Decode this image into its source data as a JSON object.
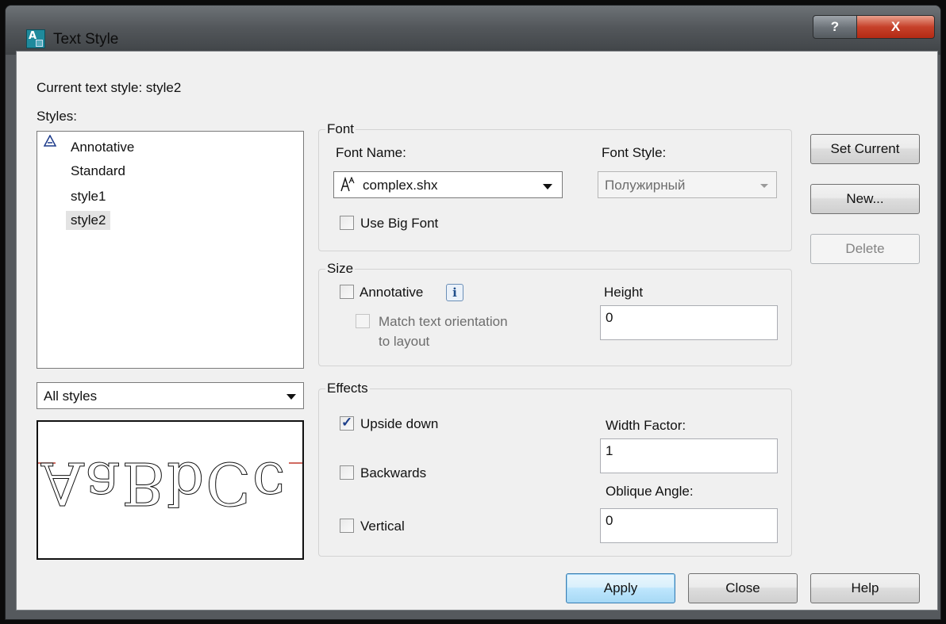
{
  "window": {
    "title": "Text Style",
    "help_button": "?",
    "close_button": "X"
  },
  "current_style": "Current text style:  style2",
  "styles_label": "Styles:",
  "styles": [
    {
      "label": "Annotative",
      "annotative": true,
      "selected": false
    },
    {
      "label": "Standard",
      "annotative": false,
      "selected": false
    },
    {
      "label": "style1",
      "annotative": false,
      "selected": false
    },
    {
      "label": "style2",
      "annotative": false,
      "selected": true
    }
  ],
  "filter": {
    "value": "All styles"
  },
  "preview": {
    "text": "AaBbCc"
  },
  "font": {
    "group_label": "Font",
    "font_name_label": "Font Name:",
    "font_name_value": "complex.shx",
    "font_style_label": "Font Style:",
    "font_style_value": "Полужирный",
    "use_big_font_label": "Use Big Font",
    "use_big_font_checked": false
  },
  "size": {
    "group_label": "Size",
    "annotative_label": "Annotative",
    "annotative_checked": false,
    "info_icon": "i",
    "match_orientation_label_1": "Match text orientation",
    "match_orientation_label_2": "to layout",
    "height_label": "Height",
    "height_value": "0"
  },
  "effects": {
    "group_label": "Effects",
    "upside_down_label": "Upside down",
    "upside_down_checked": true,
    "backwards_label": "Backwards",
    "backwards_checked": false,
    "vertical_label": "Vertical",
    "vertical_checked": false,
    "width_factor_label": "Width Factor:",
    "width_factor_value": "1",
    "oblique_angle_label": "Oblique Angle:",
    "oblique_angle_value": "0"
  },
  "buttons": {
    "set_current": "Set Current",
    "new": "New...",
    "delete": "Delete",
    "apply": "Apply",
    "close": "Close",
    "help": "Help"
  },
  "colors": {
    "title_bar": "#53575b",
    "close_red": "#c6412a",
    "preview_baseline": "#c0392b",
    "default_button_border": "#3c7fb1"
  },
  "icons": {
    "app": "autocad-text-style-icon",
    "font_type": "shx-font-icon",
    "annotative": "annotative-scale-icon"
  }
}
